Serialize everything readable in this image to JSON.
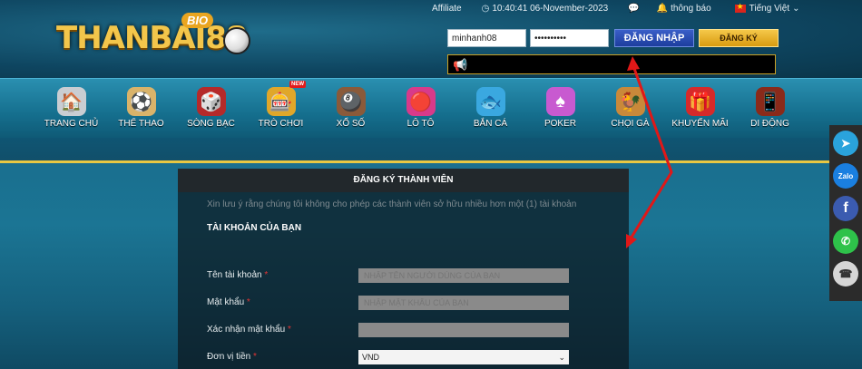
{
  "logo": {
    "text": "THANBAI88",
    "badge": "BIO"
  },
  "topbar": {
    "affiliate": "Affiliate",
    "datetime": "10:40:41 06-November-2023",
    "notification": "thông báo",
    "language": "Tiếng Việt"
  },
  "login": {
    "username_value": "minhanh08",
    "password_value": "••••••••••",
    "login_label": "ĐĂNG NHẬP",
    "register_label": "ĐĂNG KÝ"
  },
  "nav": {
    "items": [
      {
        "label": "TRANG CHỦ",
        "icon": "house-icon"
      },
      {
        "label": "THỂ THAO",
        "icon": "sports-ball-icon"
      },
      {
        "label": "SÒNG BẠC",
        "icon": "casino-chips-icon"
      },
      {
        "label": "TRÒ CHƠI",
        "icon": "slot-machine-icon",
        "badge": "NEW"
      },
      {
        "label": "XỔ SỐ",
        "icon": "lottery-icon"
      },
      {
        "label": "LÔ TÔ",
        "icon": "lotto-balls-icon"
      },
      {
        "label": "BẮN CÁ",
        "icon": "fish-icon"
      },
      {
        "label": "POKER",
        "icon": "poker-cards-icon"
      },
      {
        "label": "CHỌI GÀ",
        "icon": "rooster-icon"
      },
      {
        "label": "KHUYẾN MÃI",
        "icon": "gift-icon"
      },
      {
        "label": "DI ĐỘNG",
        "icon": "mobile-icon"
      }
    ]
  },
  "form": {
    "title": "ĐĂNG KÝ THÀNH VIÊN",
    "notice": "Xin lưu ý rằng chúng tôi không cho phép các thành viên sở hữu nhiều hơn một (1) tài khoản",
    "section": "TÀI KHOẢN CỦA BẠN",
    "fields": [
      {
        "label": "Tên tài khoản",
        "required": "*",
        "placeholder": "NHẬP TÊN NGƯỜI DÙNG CỦA BẠN"
      },
      {
        "label": "Mật khẩu",
        "required": "*",
        "placeholder": "NHẬP MẬT KHẨU CỦA BẠN"
      },
      {
        "label": "Xác nhận mật khẩu",
        "required": "*",
        "placeholder": ""
      },
      {
        "label": "Đơn vị tiền",
        "required": "*",
        "value": "VND"
      }
    ]
  },
  "social": [
    "telegram-icon",
    "zalo-icon",
    "facebook-icon",
    "whatsapp-icon",
    "phone-icon"
  ],
  "colors": {
    "gold": "#e7c743",
    "login_blue": "#2a4fb8",
    "annotation_red": "#e01818"
  }
}
